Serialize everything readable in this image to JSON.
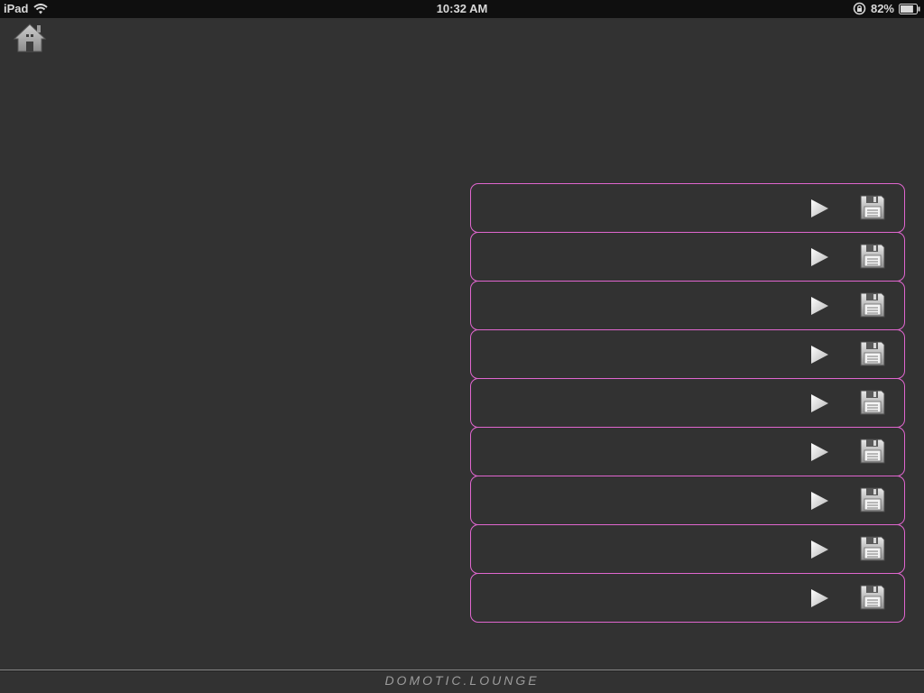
{
  "statusbar": {
    "carrier": "iPad",
    "time": "10:32 AM",
    "battery_percent": "82%",
    "battery_level": 0.82
  },
  "home": {
    "icon": "home-icon"
  },
  "slots": [
    {
      "name": ""
    },
    {
      "name": ""
    },
    {
      "name": ""
    },
    {
      "name": ""
    },
    {
      "name": ""
    },
    {
      "name": ""
    },
    {
      "name": ""
    },
    {
      "name": ""
    },
    {
      "name": ""
    }
  ],
  "footer": {
    "brand": "DOMOTIC.LOUNGE"
  },
  "colors": {
    "background": "#323232",
    "statusbar": "#0f0f0f",
    "slot_border": "#e066cf"
  }
}
